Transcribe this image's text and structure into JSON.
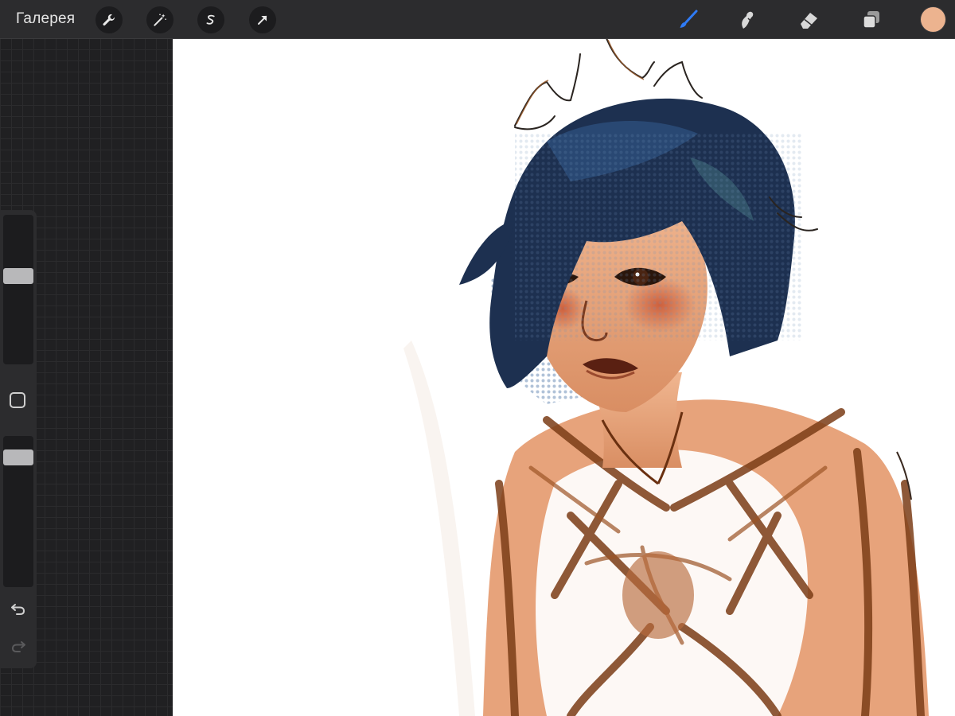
{
  "toolbar": {
    "gallery_label": "Галерея",
    "left_tools": [
      {
        "name": "wrench-icon"
      },
      {
        "name": "magic-wand-icon"
      },
      {
        "name": "selection-icon"
      },
      {
        "name": "move-arrow-icon"
      }
    ],
    "right_tools": [
      {
        "name": "brush-icon",
        "active": true
      },
      {
        "name": "smudge-icon"
      },
      {
        "name": "eraser-icon"
      },
      {
        "name": "layers-icon"
      }
    ],
    "current_color": "#ecb38f"
  },
  "sidebar": {
    "brush_size_level": 0.6,
    "opacity_level": 0.9,
    "modify_button_icon": "square-outline-icon",
    "undo_icon": "undo-arrow-icon",
    "redo_icon": "redo-arrow-icon",
    "redo_enabled": false
  },
  "colors": {
    "accent": "#2f7bf5",
    "toolbar_bg": "#2c2c2e",
    "canvas_bg": "#ffffff",
    "skin": "#d68a5f",
    "hair": "#1d3050",
    "ink": "#3a1c0c"
  }
}
